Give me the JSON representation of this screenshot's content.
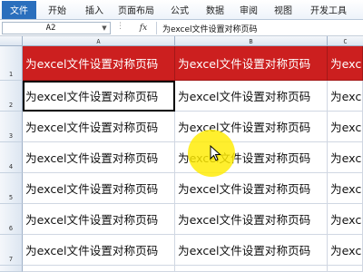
{
  "ribbon": {
    "file_tab": "文件",
    "tabs": [
      "开始",
      "插入",
      "页面布局",
      "公式",
      "数据",
      "审阅",
      "视图",
      "开发工具"
    ]
  },
  "formula_bar": {
    "name_box": "A2",
    "fx_label": "fx",
    "content": "为excel文件设置对称页码"
  },
  "columns": [
    "A",
    "B",
    "C"
  ],
  "rows": [
    "1",
    "2",
    "3",
    "4",
    "5",
    "6",
    "7"
  ],
  "cell_text": "为excel文件设置对称页码",
  "colors": {
    "header_fill": "#cc1f1f",
    "header_text": "#ffffff",
    "accent_file_tab": "#2a6fbd",
    "cursor_highlight": "#ffec00"
  }
}
